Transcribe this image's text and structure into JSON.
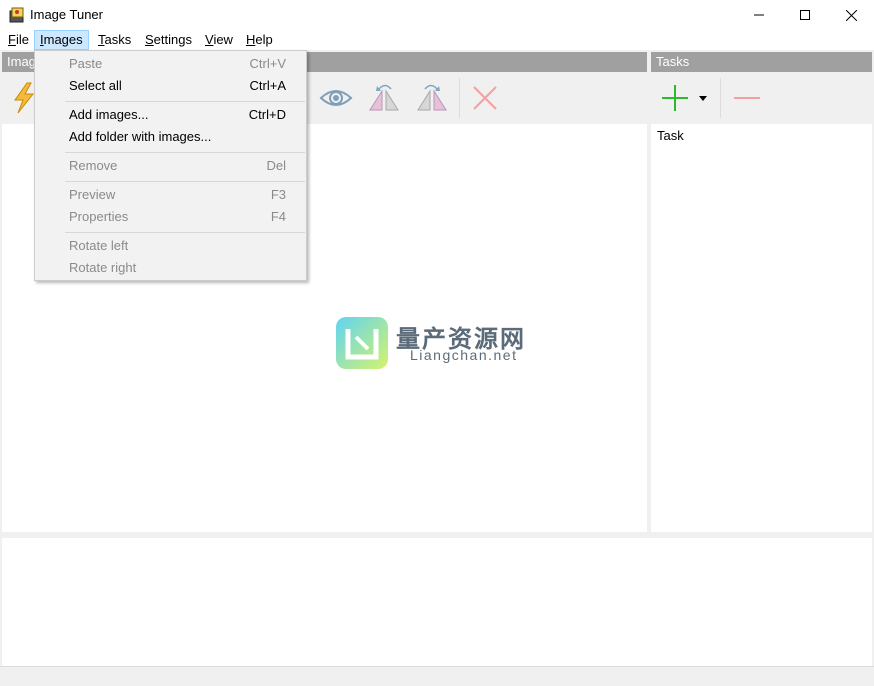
{
  "window": {
    "title": "Image Tuner",
    "controls": {
      "minimize": "minimize",
      "maximize": "maximize",
      "close": "close"
    }
  },
  "menubar": {
    "items": [
      {
        "label": "File",
        "mnemonic": "F",
        "rest": "ile"
      },
      {
        "label": "Images",
        "mnemonic": "I",
        "rest": "mages"
      },
      {
        "label": "Tasks",
        "mnemonic": "T",
        "rest": "asks"
      },
      {
        "label": "Settings",
        "mnemonic": "S",
        "rest": "ettings"
      },
      {
        "label": "View",
        "mnemonic": "V",
        "rest": "iew"
      },
      {
        "label": "Help",
        "mnemonic": "H",
        "rest": "elp"
      }
    ],
    "active": "Images"
  },
  "images_menu": {
    "items": [
      {
        "label": "Paste",
        "shortcut": "Ctrl+V",
        "enabled": false
      },
      {
        "label": "Select all",
        "shortcut": "Ctrl+A",
        "enabled": true
      },
      {
        "label": "Add images...",
        "shortcut": "Ctrl+D",
        "enabled": true
      },
      {
        "label": "Add folder with images...",
        "shortcut": "",
        "enabled": true
      },
      {
        "label": "Remove",
        "shortcut": "Del",
        "enabled": false
      },
      {
        "label": "Preview",
        "shortcut": "F3",
        "enabled": false
      },
      {
        "label": "Properties",
        "shortcut": "F4",
        "enabled": false
      },
      {
        "label": "Rotate left",
        "shortcut": "",
        "enabled": false
      },
      {
        "label": "Rotate right",
        "shortcut": "",
        "enabled": false
      }
    ]
  },
  "images_panel": {
    "header": "Imag",
    "toolbar_icons": [
      "lightning-icon",
      "eye-icon",
      "rotate-left-icon",
      "rotate-right-icon",
      "delete-x-icon"
    ]
  },
  "tasks_panel": {
    "header": "Tasks",
    "column_header": "Task",
    "toolbar_icons": [
      "plus-icon",
      "dropdown-arrow-icon",
      "minus-icon"
    ]
  },
  "watermark": {
    "chinese": "量产资源网",
    "latin": "Liangchan.net"
  },
  "colors": {
    "panel_header": "#a0a0a0",
    "menu_highlight": "#cce8ff",
    "add_green": "#2eb82e",
    "remove_red": "#e06060"
  }
}
